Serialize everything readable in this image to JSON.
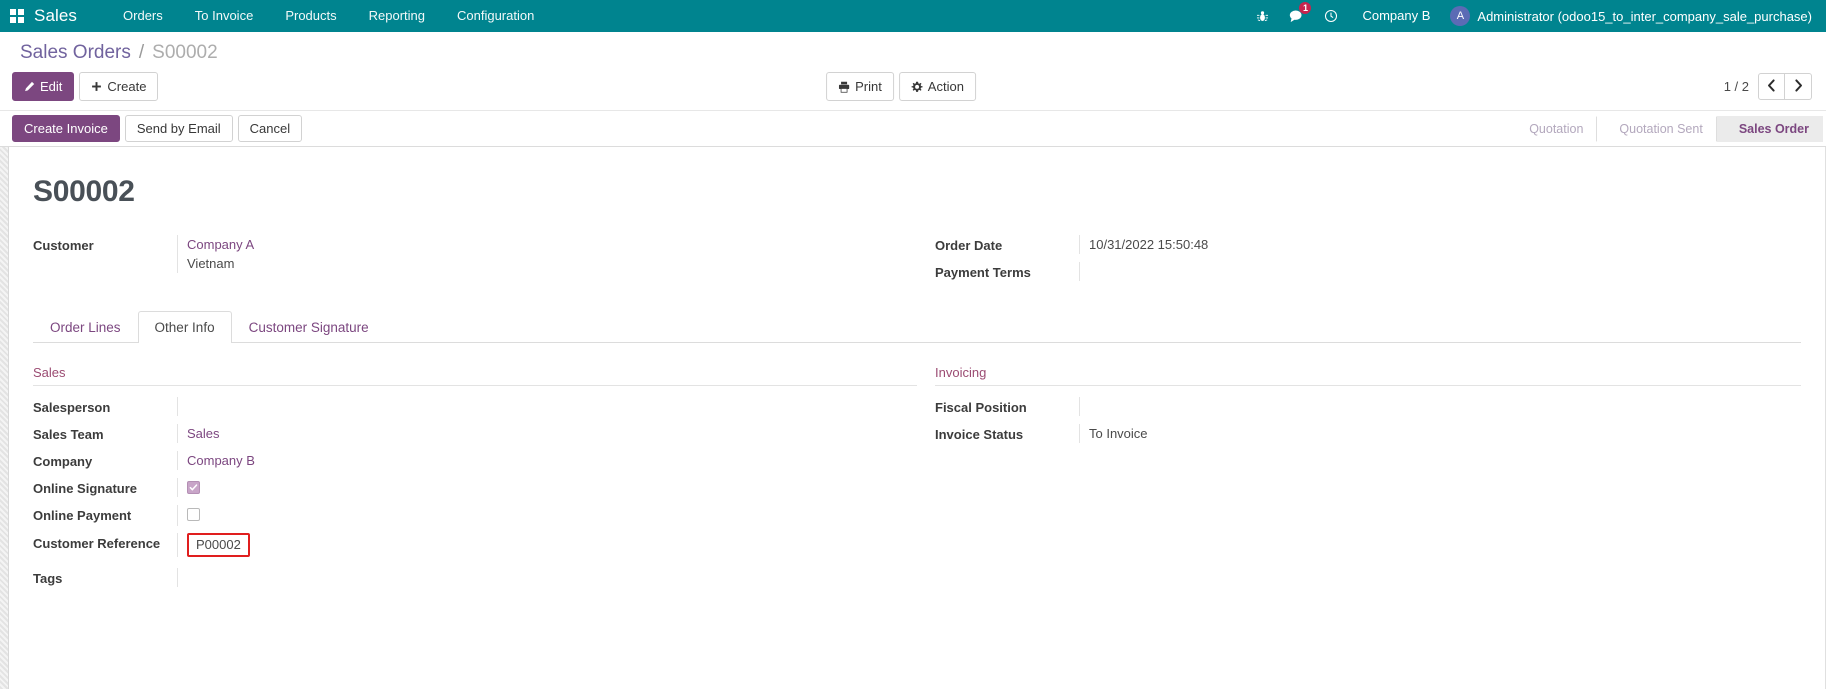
{
  "navbar": {
    "apps_icon": "apps-grid-icon",
    "brand": "Sales",
    "menu": [
      {
        "label": "Orders"
      },
      {
        "label": "To Invoice"
      },
      {
        "label": "Products"
      },
      {
        "label": "Reporting"
      },
      {
        "label": "Configuration"
      }
    ],
    "icons": [
      {
        "name": "bug-icon"
      },
      {
        "name": "messages-icon",
        "badge": "1"
      },
      {
        "name": "activity-clock-icon"
      }
    ],
    "company": "Company B",
    "user": {
      "initial": "A",
      "name": "Administrator (odoo15_to_inter_company_sale_purchase)",
      "avatar_color": "#5b6bb5"
    }
  },
  "control_panel": {
    "breadcrumb": {
      "root": "Sales Orders",
      "separator": "/",
      "current": "S00002"
    },
    "edit_label": "Edit",
    "create_label": "Create",
    "print_label": "Print",
    "action_label": "Action",
    "pager": {
      "count": "1 / 2",
      "prev_icon": "chevron-left-icon",
      "next_icon": "chevron-right-icon"
    }
  },
  "statusbar": {
    "buttons": [
      {
        "label": "Create Invoice",
        "style": "primary"
      },
      {
        "label": "Send by Email",
        "style": "secondary"
      },
      {
        "label": "Cancel",
        "style": "secondary"
      }
    ],
    "stages": [
      {
        "label": "Quotation",
        "active": false
      },
      {
        "label": "Quotation Sent",
        "active": false
      },
      {
        "label": "Sales Order",
        "active": true
      }
    ]
  },
  "form": {
    "record_title": "S00002",
    "left": {
      "customer_label": "Customer",
      "customer_value": "Company A",
      "customer_country": "Vietnam"
    },
    "right": {
      "order_date_label": "Order Date",
      "order_date_value": "10/31/2022 15:50:48",
      "payment_terms_label": "Payment Terms",
      "payment_terms_value": ""
    }
  },
  "notebook": {
    "tabs": [
      {
        "label": "Order Lines",
        "active": false
      },
      {
        "label": "Other Info",
        "active": true
      },
      {
        "label": "Customer Signature",
        "active": false
      }
    ]
  },
  "other_info": {
    "sales": {
      "section_title": "Sales",
      "fields": [
        {
          "label": "Salesperson",
          "value": "",
          "type": "text"
        },
        {
          "label": "Sales Team",
          "value": "Sales",
          "type": "link"
        },
        {
          "label": "Company",
          "value": "Company B",
          "type": "link"
        },
        {
          "label": "Online Signature",
          "value": "",
          "type": "checkbox",
          "checked": true
        },
        {
          "label": "Online Payment",
          "value": "",
          "type": "checkbox",
          "checked": false
        },
        {
          "label": "Customer Reference",
          "value": "P00002",
          "type": "highlighted-input"
        },
        {
          "label": "Tags",
          "value": "",
          "type": "text"
        }
      ]
    },
    "invoicing": {
      "section_title": "Invoicing",
      "fields": [
        {
          "label": "Fiscal Position",
          "value": "",
          "type": "text"
        },
        {
          "label": "Invoice Status",
          "value": "To Invoice",
          "type": "text"
        }
      ]
    }
  },
  "colors": {
    "navbar_bg": "#00848f",
    "primary": "#7c4780",
    "accent_link": "#7c4780",
    "section_heading": "#9b4b72",
    "highlight_border": "#e01e1e",
    "badge": "#c7254e"
  }
}
